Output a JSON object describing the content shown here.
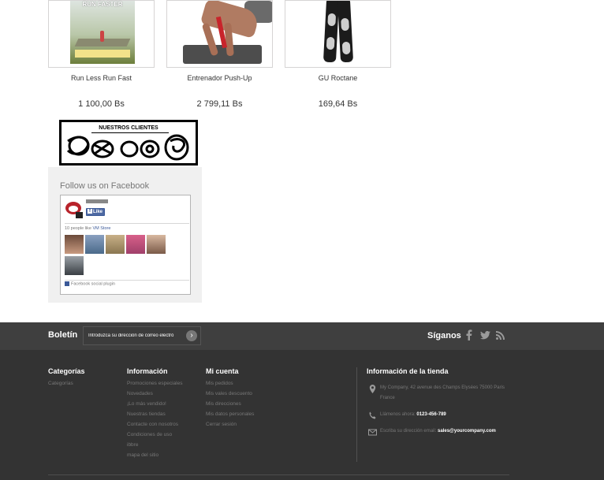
{
  "products": [
    {
      "name": "Run Less Run Fast",
      "price": "1 100,00 Bs",
      "cover_text": "RUN FASTER"
    },
    {
      "name": "Entrenador Push-Up",
      "price": "2 799,11 Bs"
    },
    {
      "name": "GU Roctane",
      "price": "169,64 Bs"
    }
  ],
  "clients": {
    "title": "NUESTROS CLIENTES"
  },
  "facebook": {
    "heading": "Follow us on Facebook",
    "like_label": "Like",
    "people_count": "10 people like",
    "page_name": "VM Store",
    "plugin_label": "Facebook social plugin"
  },
  "newsletter": {
    "label": "Boletín",
    "placeholder": "Introduzca su dirección de correo electró"
  },
  "social": {
    "label": "Síganos",
    "icons": [
      "facebook-icon",
      "twitter-icon",
      "rss-icon"
    ]
  },
  "footer": {
    "categories": {
      "heading": "Categorías",
      "items": [
        "Categorías"
      ]
    },
    "information": {
      "heading": "Información",
      "items": [
        "Promociones especiales",
        "Novedades",
        "¡Lo más vendido!",
        "Nuestras tiendas",
        "Contacte con nosotros",
        "Condiciones de uso",
        "ibbre",
        "mapa del sitio"
      ]
    },
    "account": {
      "heading": "Mi cuenta",
      "items": [
        "Mis pedidos",
        "Mis vales descuento",
        "Mis direcciones",
        "Mis datos personales",
        "Cerrar sesión"
      ]
    },
    "store": {
      "heading": "Información de la tienda",
      "address": "My Company, 42 avenue des Champs Elysées 75000 Paris France",
      "phone_label": "Llámenos ahora:",
      "phone": "0123-456-789",
      "email_label": "Escriba su dirección email:",
      "email": "sales@yourcompany.com"
    }
  },
  "colors": {
    "footer_bg": "#333333",
    "newsletter_bg": "#3f3f3f",
    "facebook_blue": "#3b5998"
  }
}
